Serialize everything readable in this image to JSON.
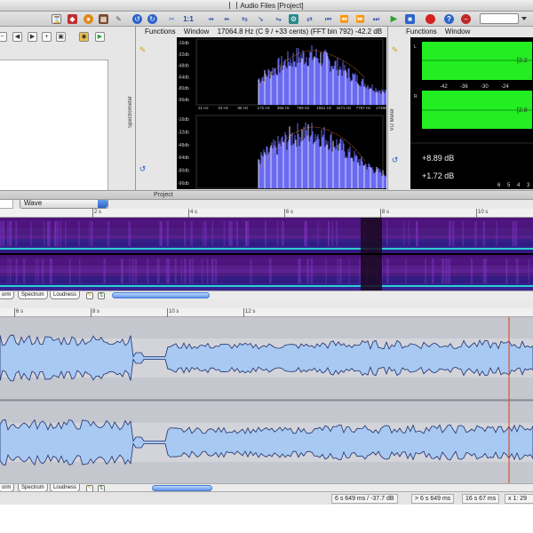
{
  "window": {
    "title": "Audio Files [Project]"
  },
  "toolbar": {
    "ratio_label": "1:1"
  },
  "left_panel": {
    "wave_select": "Wave"
  },
  "spectrometer": {
    "side_title": "Spectrometer",
    "menu": [
      "Functions",
      "Window"
    ],
    "readout": "17064.8 Hz (C 9 / +33 cents) (FFT bin 792) -42.2 dB",
    "db_labels": [
      "-16db",
      "-32db",
      "-48db",
      "-64db",
      "-80db",
      "-96db"
    ],
    "freq_labels": [
      "21 Hz",
      "43 Hz",
      "86 Hz",
      "172 Hz",
      "366 Hz",
      "759 Hz",
      "1551 Hz",
      "3471 Hz",
      "7767 Hz",
      "17380 Hz"
    ]
  },
  "vu_meter": {
    "side_title": "VU Meter",
    "menu": [
      "Functions",
      "Window"
    ],
    "scale": [
      "-42",
      "-36",
      "-30",
      "-24"
    ],
    "channel_l": "L",
    "channel_r": "R",
    "peak_l": "[2.2",
    "peak_r": "[2.8",
    "level_l": "+8.89 dB",
    "level_r": "+1.72 dB",
    "bottom_scale": [
      "6",
      "5",
      "4",
      "3"
    ]
  },
  "project_tab": "Project",
  "spectrogram_ruler": [
    "2 s",
    "4 s",
    "6 s",
    "8 s",
    "10 s"
  ],
  "waveform_ruler": [
    "6 s",
    "8 s",
    "10 s",
    "12 s"
  ],
  "view_tabs": {
    "waveform": "orm",
    "spectrum": "Spectrum",
    "loudness": "Loudness"
  },
  "status": {
    "position": "6 s 649 ms / -37.7 dB",
    "selection": "> 6 s 649 ms",
    "length": "16 s 67 ms",
    "zoom": "x 1: 29"
  },
  "colors": {
    "spectrogram_bg": "#2a0a5a",
    "waveform_fill": "#a8c9f2",
    "waveform_line": "#1e2e6e",
    "vu_green": "#22ee22",
    "cursor": "#e03a1a"
  }
}
